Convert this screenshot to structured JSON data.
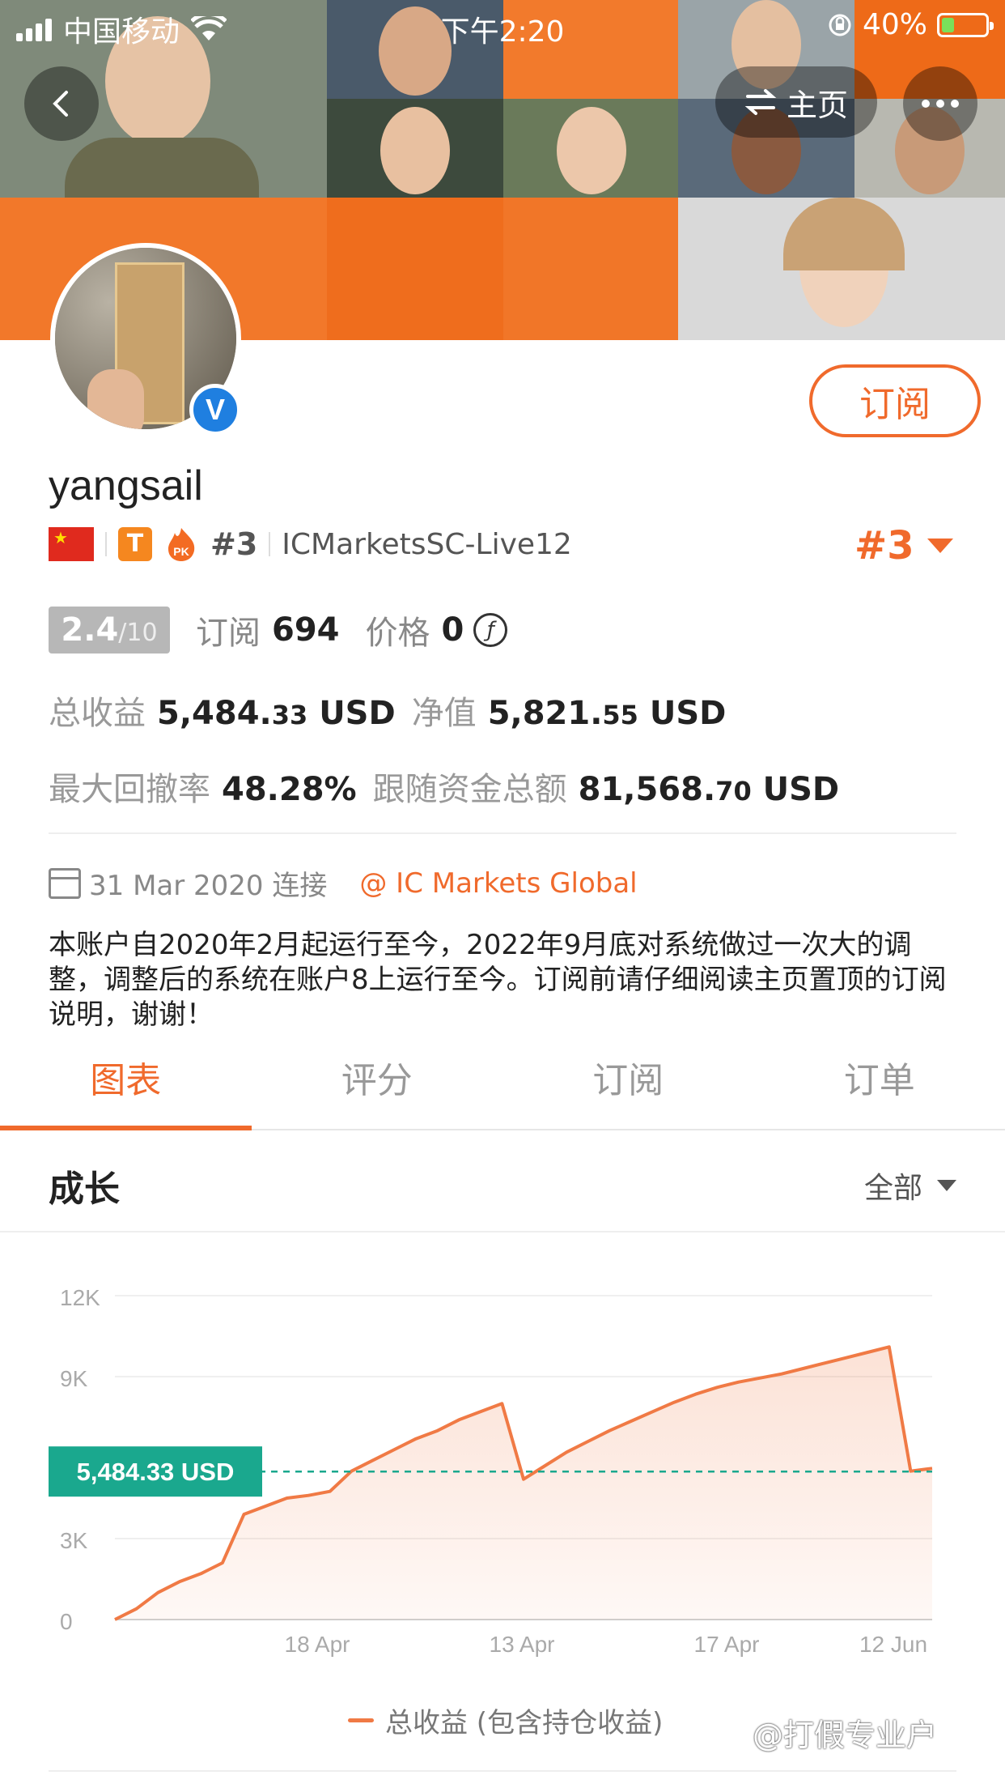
{
  "status_bar": {
    "carrier": "中国移动",
    "time": "下午2:20",
    "battery": "40%"
  },
  "header": {
    "home_label": "主页"
  },
  "profile": {
    "username": "yangsail",
    "subscribe_label": "订阅",
    "rank_small": "#3",
    "server": "ICMarketsSC-Live12",
    "rank_big": "#3",
    "t_badge": "T",
    "pk_badge": "PK",
    "verified": "V"
  },
  "stats": {
    "score_main": "2.4",
    "score_suffix": "/10",
    "subscribers_label": "订阅",
    "subscribers_value": "694",
    "price_label": "价格",
    "price_value": "0",
    "coin_symbol": "ƒ"
  },
  "money": {
    "total_profit_label": "总收益",
    "total_profit_int": "5,484.",
    "total_profit_dec": "33",
    "total_profit_unit": "USD",
    "equity_label": "净值",
    "equity_int": "5,821.",
    "equity_dec": "55",
    "equity_unit": "USD",
    "max_drawdown_label": "最大回撤率",
    "max_drawdown_value": "48.28%",
    "follow_funds_label": "跟随资金总额",
    "follow_funds_int": "81,568.",
    "follow_funds_dec": "70",
    "follow_funds_unit": "USD"
  },
  "connection": {
    "date": "31 Mar 2020 连接",
    "broker": "@ IC Markets Global"
  },
  "description": "本账户自2020年2月起运行至今，2022年9月底对系统做过一次大的调整，调整后的系统在账户8上运行至今。订阅前请仔细阅读主页置顶的订阅说明，谢谢！",
  "tabs": [
    "图表",
    "评分",
    "订阅",
    "订单"
  ],
  "section": {
    "title": "成长",
    "range": "全部"
  },
  "chart_data": {
    "type": "area",
    "title": "",
    "y_ticks": [
      "12K",
      "9K",
      "3K",
      "0"
    ],
    "x_ticks": [
      "18 Apr",
      "13 Apr",
      "17 Apr",
      "12 Jun"
    ],
    "ylim": [
      0,
      12000
    ],
    "current_value": 5484.33,
    "current_label": "5,484.33 USD",
    "series": [
      {
        "name": "总收益 (包含持仓收益)",
        "color": "#f07a45",
        "values": [
          0,
          400,
          1000,
          1400,
          1700,
          2100,
          3900,
          4200,
          4500,
          4600,
          4750,
          5500,
          5900,
          6300,
          6700,
          7000,
          7400,
          7700,
          8000,
          5200,
          5700,
          6200,
          6600,
          7000,
          7350,
          7700,
          8050,
          8350,
          8600,
          8800,
          8950,
          9100,
          9300,
          9500,
          9700,
          9900,
          10100,
          5500,
          5600
        ]
      }
    ]
  },
  "legend_label": "总收益 (包含持仓收益)",
  "watermark": "@打假专业户",
  "colors": {
    "accent": "#f06a2c",
    "teal": "#1aa88e",
    "banner": "#f06a1c"
  }
}
